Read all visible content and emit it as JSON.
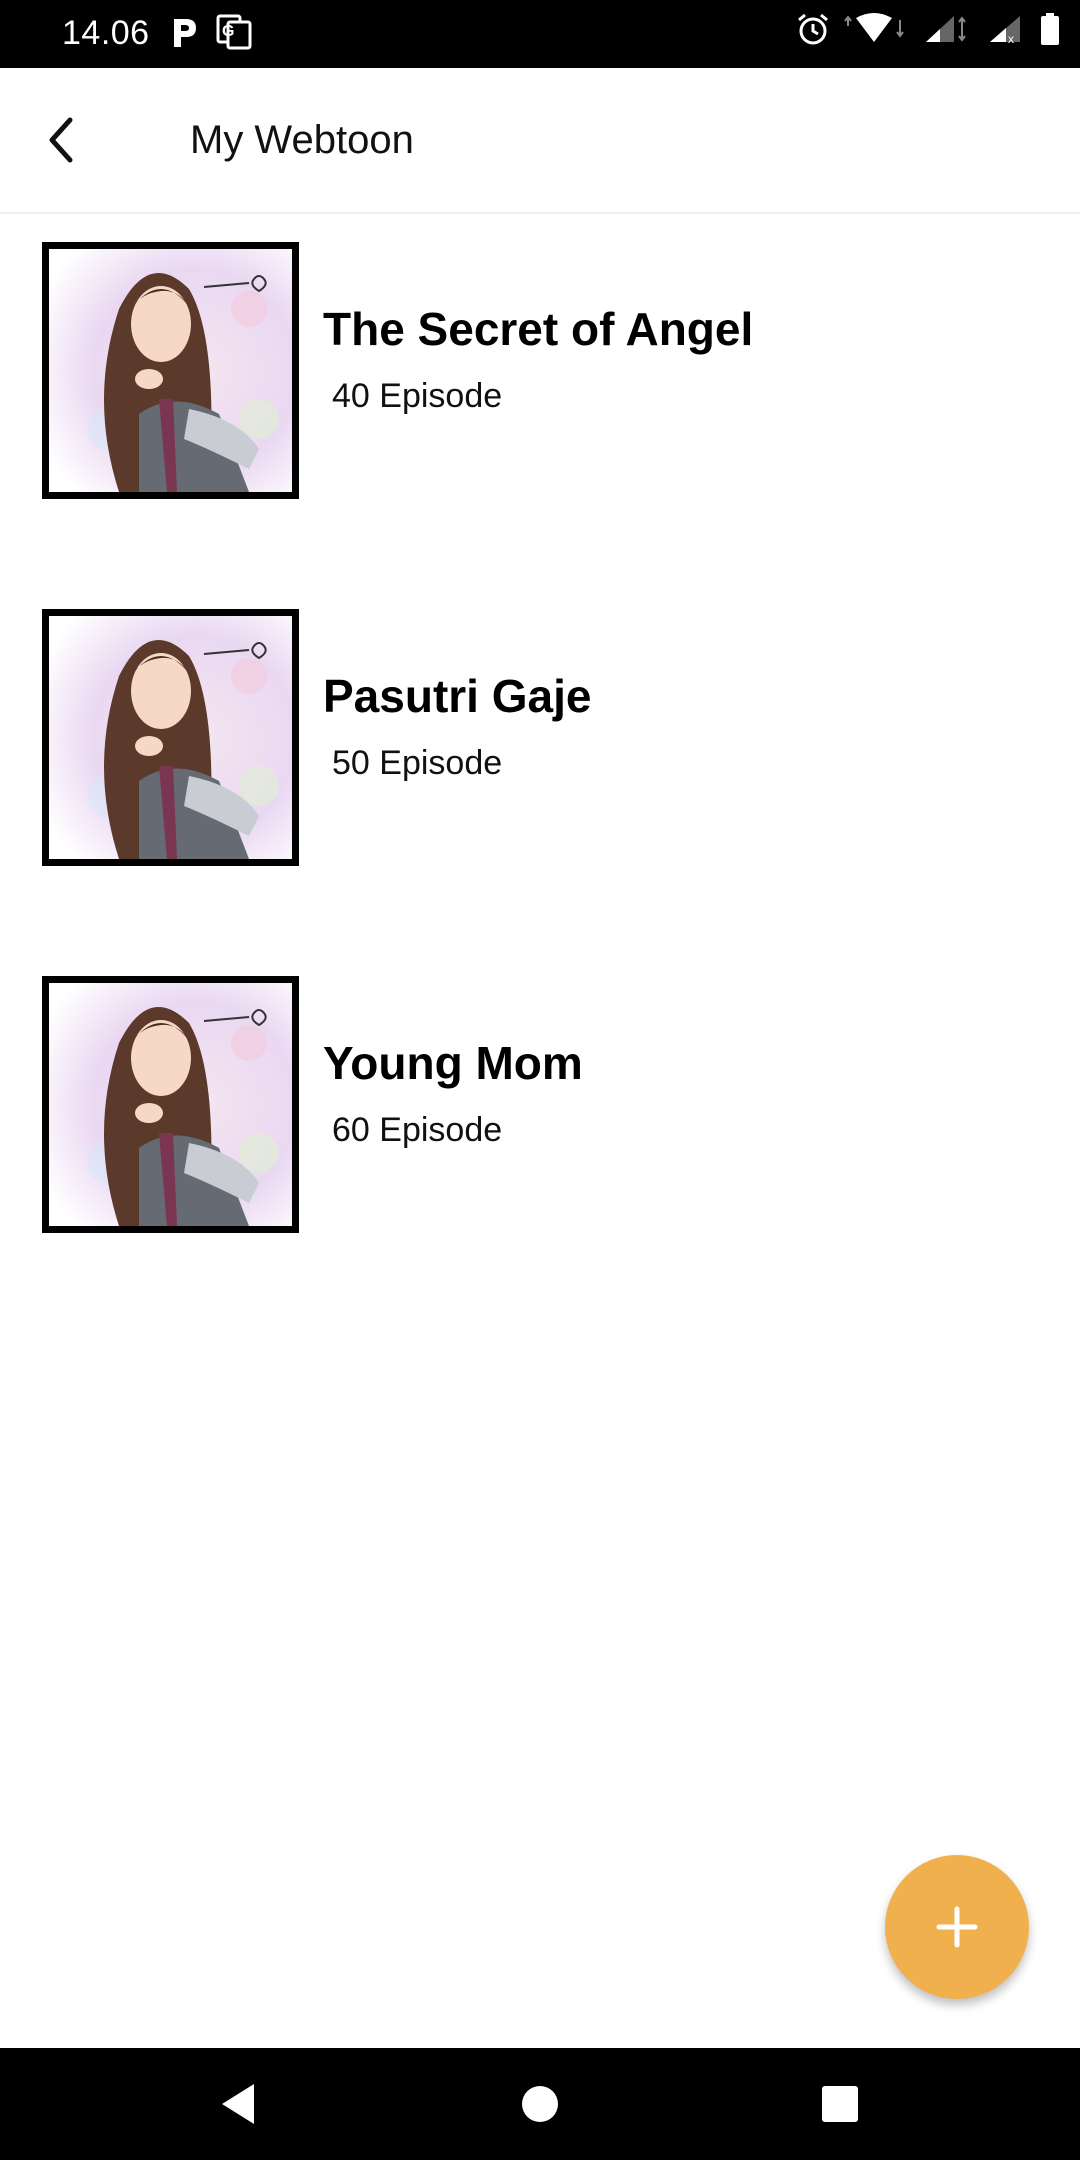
{
  "status_bar": {
    "time": "14.06",
    "icons": [
      "p-app-icon",
      "translate-icon",
      "alarm-icon",
      "wifi-icon",
      "signal-icon",
      "signal-icon",
      "battery-icon"
    ]
  },
  "app_bar": {
    "title": "My Webtoon",
    "back_icon": "back-arrow-icon"
  },
  "webtoons": [
    {
      "title": "The Secret of Angel",
      "episodes": "40 Episode"
    },
    {
      "title": "Pasutri Gaje",
      "episodes": "50 Episode"
    },
    {
      "title": "Young Mom",
      "episodes": "60 Episode"
    }
  ],
  "fab": {
    "icon": "plus-icon",
    "color": "#f0b04e"
  },
  "nav_bar": {
    "buttons": [
      "back-triangle-icon",
      "home-circle-icon",
      "recents-square-icon"
    ]
  }
}
